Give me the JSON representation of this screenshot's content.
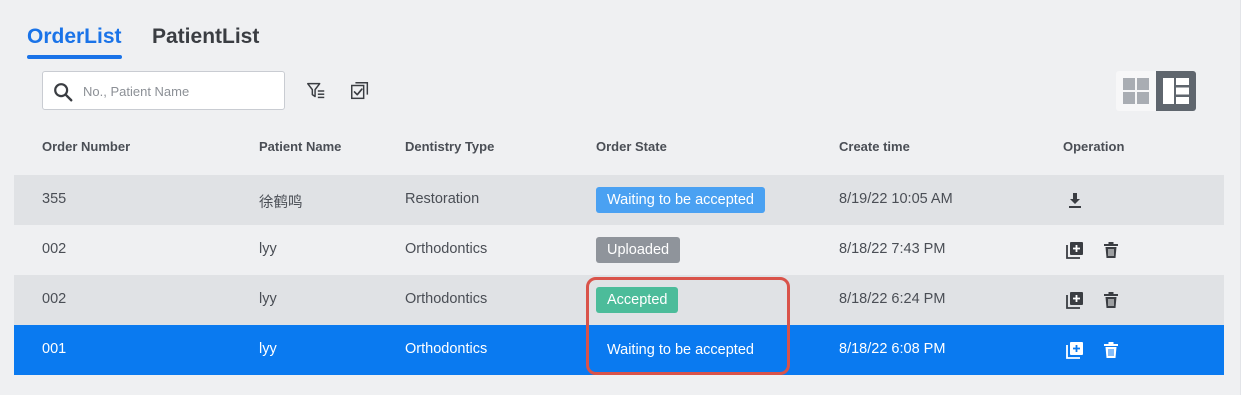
{
  "tabs": [
    {
      "label": "OrderList",
      "active": true
    },
    {
      "label": "PatientList",
      "active": false
    }
  ],
  "search": {
    "placeholder": "No., Patient Name",
    "value": ""
  },
  "toolbar": {
    "filter_icon": "filter-icon",
    "select_icon": "checklist-icon"
  },
  "view_toggle": {
    "options": [
      "grid-view",
      "list-view"
    ],
    "active": "list-view"
  },
  "table": {
    "columns": [
      "Order Number",
      "Patient Name",
      "Dentistry Type",
      "Order State",
      "Create time",
      "Operation"
    ],
    "rows": [
      {
        "order_number": "355",
        "patient_name": "徐鹤鸣",
        "dentistry_type": "Restoration",
        "order_state": "Waiting to be accepted",
        "create_time": "8/19/22 10:05 AM",
        "operations": [
          "download-icon"
        ]
      },
      {
        "order_number": "002",
        "patient_name": "lyy",
        "dentistry_type": "Orthodontics",
        "order_state": "Uploaded",
        "create_time": "8/18/22 7:43 PM",
        "operations": [
          "copy-add-icon",
          "delete-icon"
        ]
      },
      {
        "order_number": "002",
        "patient_name": "lyy",
        "dentistry_type": "Orthodontics",
        "order_state": "Accepted",
        "create_time": "8/18/22 6:24 PM",
        "operations": [
          "copy-add-icon",
          "delete-icon"
        ]
      },
      {
        "order_number": "001",
        "patient_name": "lyy",
        "dentistry_type": "Orthodontics",
        "order_state": "Waiting to be accepted",
        "create_time": "8/18/22 6:08 PM",
        "operations": [
          "copy-add-icon",
          "delete-icon"
        ],
        "selected": true
      }
    ]
  },
  "colors": {
    "accent": "#1a73e8",
    "selected_row": "#0a7af0",
    "waiting": "#4aa1f2",
    "uploaded": "#8f949b",
    "accepted": "#4cbc9a",
    "highlight": "#d9534a"
  }
}
